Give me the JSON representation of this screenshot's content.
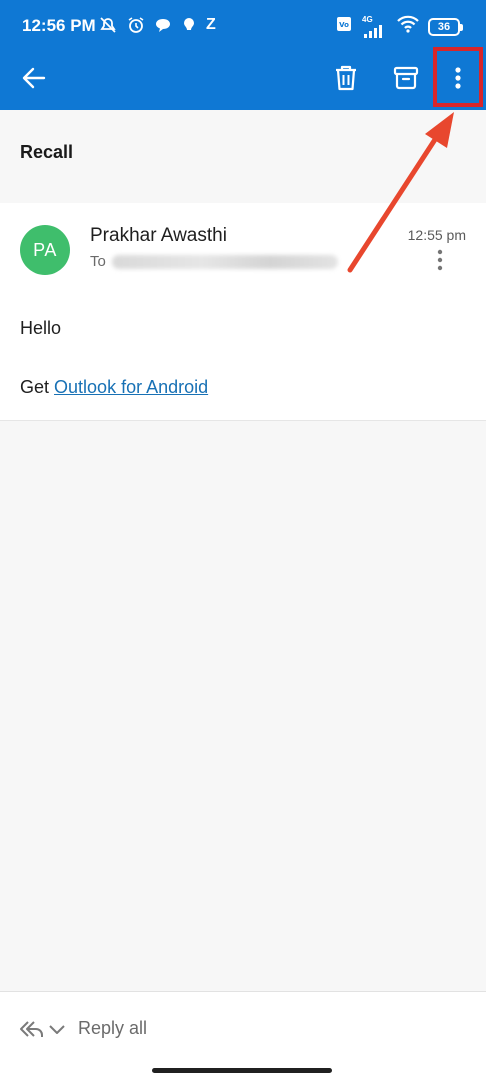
{
  "statusbar": {
    "time": "12:56 PM",
    "z_label": "Z",
    "network_label": "4G",
    "battery_level": "36"
  },
  "toolbar": {
    "back_icon": "arrow-left-icon",
    "delete_icon": "trash-icon",
    "archive_icon": "archive-icon",
    "more_icon": "more-vertical-icon"
  },
  "email": {
    "subject": "Recall",
    "avatar_initials": "PA",
    "sender_name": "Prakhar Awasthi",
    "to_prefix": "To",
    "time": "12:55 pm",
    "body_greeting": "Hello",
    "body_prefix": "Get",
    "body_link": "Outlook for Android"
  },
  "bottom": {
    "reply_all_label": "Reply all"
  },
  "colors": {
    "appbar": "#0f78d4",
    "avatar": "#3fbe6c",
    "link": "#1871b5",
    "annotation": "#d8262a"
  }
}
